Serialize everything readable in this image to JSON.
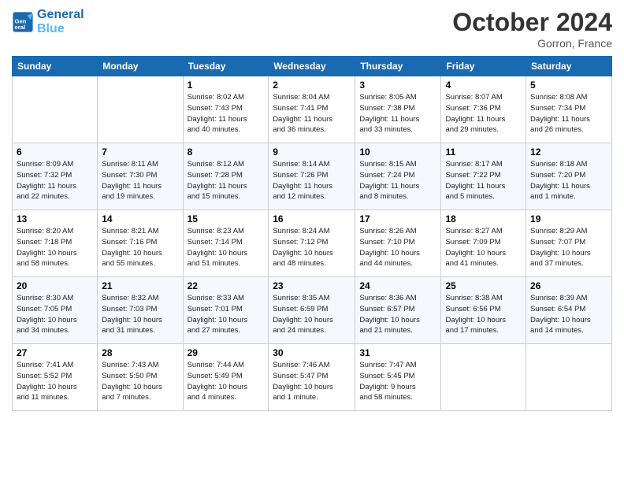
{
  "logo": {
    "line1": "General",
    "line2": "Blue"
  },
  "title": "October 2024",
  "location": "Gorron, France",
  "headers": [
    "Sunday",
    "Monday",
    "Tuesday",
    "Wednesday",
    "Thursday",
    "Friday",
    "Saturday"
  ],
  "rows": [
    [
      {
        "day": "",
        "info": ""
      },
      {
        "day": "",
        "info": ""
      },
      {
        "day": "1",
        "info": "Sunrise: 8:02 AM\nSunset: 7:43 PM\nDaylight: 11 hours\nand 40 minutes."
      },
      {
        "day": "2",
        "info": "Sunrise: 8:04 AM\nSunset: 7:41 PM\nDaylight: 11 hours\nand 36 minutes."
      },
      {
        "day": "3",
        "info": "Sunrise: 8:05 AM\nSunset: 7:38 PM\nDaylight: 11 hours\nand 33 minutes."
      },
      {
        "day": "4",
        "info": "Sunrise: 8:07 AM\nSunset: 7:36 PM\nDaylight: 11 hours\nand 29 minutes."
      },
      {
        "day": "5",
        "info": "Sunrise: 8:08 AM\nSunset: 7:34 PM\nDaylight: 11 hours\nand 26 minutes."
      }
    ],
    [
      {
        "day": "6",
        "info": "Sunrise: 8:09 AM\nSunset: 7:32 PM\nDaylight: 11 hours\nand 22 minutes."
      },
      {
        "day": "7",
        "info": "Sunrise: 8:11 AM\nSunset: 7:30 PM\nDaylight: 11 hours\nand 19 minutes."
      },
      {
        "day": "8",
        "info": "Sunrise: 8:12 AM\nSunset: 7:28 PM\nDaylight: 11 hours\nand 15 minutes."
      },
      {
        "day": "9",
        "info": "Sunrise: 8:14 AM\nSunset: 7:26 PM\nDaylight: 11 hours\nand 12 minutes."
      },
      {
        "day": "10",
        "info": "Sunrise: 8:15 AM\nSunset: 7:24 PM\nDaylight: 11 hours\nand 8 minutes."
      },
      {
        "day": "11",
        "info": "Sunrise: 8:17 AM\nSunset: 7:22 PM\nDaylight: 11 hours\nand 5 minutes."
      },
      {
        "day": "12",
        "info": "Sunrise: 8:18 AM\nSunset: 7:20 PM\nDaylight: 11 hours\nand 1 minute."
      }
    ],
    [
      {
        "day": "13",
        "info": "Sunrise: 8:20 AM\nSunset: 7:18 PM\nDaylight: 10 hours\nand 58 minutes."
      },
      {
        "day": "14",
        "info": "Sunrise: 8:21 AM\nSunset: 7:16 PM\nDaylight: 10 hours\nand 55 minutes."
      },
      {
        "day": "15",
        "info": "Sunrise: 8:23 AM\nSunset: 7:14 PM\nDaylight: 10 hours\nand 51 minutes."
      },
      {
        "day": "16",
        "info": "Sunrise: 8:24 AM\nSunset: 7:12 PM\nDaylight: 10 hours\nand 48 minutes."
      },
      {
        "day": "17",
        "info": "Sunrise: 8:26 AM\nSunset: 7:10 PM\nDaylight: 10 hours\nand 44 minutes."
      },
      {
        "day": "18",
        "info": "Sunrise: 8:27 AM\nSunset: 7:09 PM\nDaylight: 10 hours\nand 41 minutes."
      },
      {
        "day": "19",
        "info": "Sunrise: 8:29 AM\nSunset: 7:07 PM\nDaylight: 10 hours\nand 37 minutes."
      }
    ],
    [
      {
        "day": "20",
        "info": "Sunrise: 8:30 AM\nSunset: 7:05 PM\nDaylight: 10 hours\nand 34 minutes."
      },
      {
        "day": "21",
        "info": "Sunrise: 8:32 AM\nSunset: 7:03 PM\nDaylight: 10 hours\nand 31 minutes."
      },
      {
        "day": "22",
        "info": "Sunrise: 8:33 AM\nSunset: 7:01 PM\nDaylight: 10 hours\nand 27 minutes."
      },
      {
        "day": "23",
        "info": "Sunrise: 8:35 AM\nSunset: 6:59 PM\nDaylight: 10 hours\nand 24 minutes."
      },
      {
        "day": "24",
        "info": "Sunrise: 8:36 AM\nSunset: 6:57 PM\nDaylight: 10 hours\nand 21 minutes."
      },
      {
        "day": "25",
        "info": "Sunrise: 8:38 AM\nSunset: 6:56 PM\nDaylight: 10 hours\nand 17 minutes."
      },
      {
        "day": "26",
        "info": "Sunrise: 8:39 AM\nSunset: 6:54 PM\nDaylight: 10 hours\nand 14 minutes."
      }
    ],
    [
      {
        "day": "27",
        "info": "Sunrise: 7:41 AM\nSunset: 5:52 PM\nDaylight: 10 hours\nand 11 minutes."
      },
      {
        "day": "28",
        "info": "Sunrise: 7:43 AM\nSunset: 5:50 PM\nDaylight: 10 hours\nand 7 minutes."
      },
      {
        "day": "29",
        "info": "Sunrise: 7:44 AM\nSunset: 5:49 PM\nDaylight: 10 hours\nand 4 minutes."
      },
      {
        "day": "30",
        "info": "Sunrise: 7:46 AM\nSunset: 5:47 PM\nDaylight: 10 hours\nand 1 minute."
      },
      {
        "day": "31",
        "info": "Sunrise: 7:47 AM\nSunset: 5:45 PM\nDaylight: 9 hours\nand 58 minutes."
      },
      {
        "day": "",
        "info": ""
      },
      {
        "day": "",
        "info": ""
      }
    ]
  ]
}
